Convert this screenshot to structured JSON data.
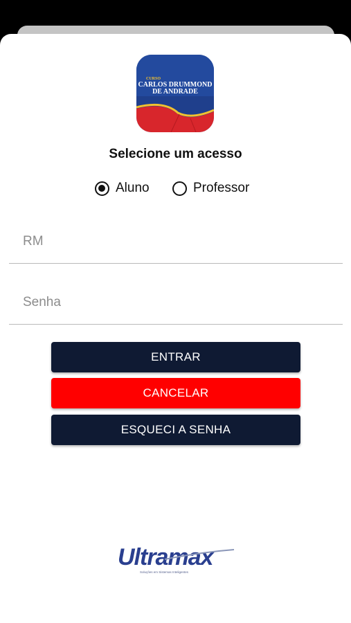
{
  "app_logo": {
    "line1": "CURSO",
    "line2": "CARLOS DRUMMOND",
    "line3": "DE ANDRADE"
  },
  "access": {
    "title": "Selecione um acesso",
    "options": [
      {
        "label": "Aluno",
        "checked": true
      },
      {
        "label": "Professor",
        "checked": false
      }
    ]
  },
  "form": {
    "rm_placeholder": "RM",
    "password_placeholder": "Senha"
  },
  "buttons": {
    "login": "ENTRAR",
    "cancel": "CANCELAR",
    "forgot": "ESQUECI A SENHA"
  },
  "colors": {
    "primary": "#0f1a33",
    "danger": "#ff0000",
    "brand_blue": "#2a3f8f"
  },
  "brand": {
    "name": "Ultramax",
    "tagline": "Soluções em Sistemas Inteligentes"
  }
}
